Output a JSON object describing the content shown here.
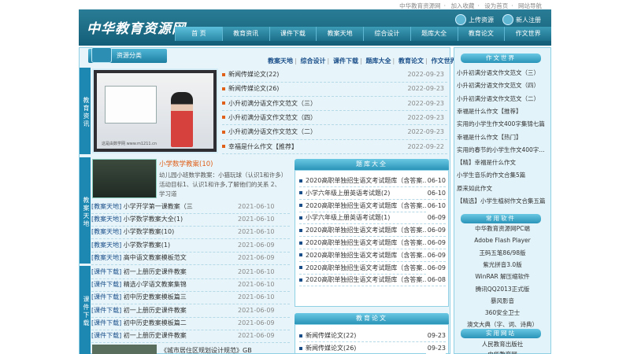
{
  "top": {
    "links": [
      "中华教育资源网",
      "加入收藏",
      "设为首页",
      "网站导航"
    ],
    "sep": "·"
  },
  "header": {
    "logo": "中华教育资源网",
    "upload": "上传资源",
    "register": "新人注册",
    "nav": [
      "首 页",
      "教育资讯",
      "课件下载",
      "教案天地",
      "综合设计",
      "题库大全",
      "教育论文",
      "作文世界"
    ]
  },
  "section1": {
    "title": "资源分类",
    "vtab": "教育资讯",
    "catlinks": [
      "教案天地",
      "综合设计",
      "课件下载",
      "题库大全",
      "教育论文",
      "作文世界"
    ],
    "video_caption": "这是由数学网 www.m1211.cn",
    "news": [
      {
        "title": "新闻传媒论文(22)",
        "date": "2022-09-23"
      },
      {
        "title": "新闻传媒论文(26)",
        "date": "2022-09-23"
      },
      {
        "title": "小升初满分语文作文范文（三）",
        "date": "2022-09-23"
      },
      {
        "title": "小升初满分语文作文范文（四）",
        "date": "2022-09-23"
      },
      {
        "title": "小升初满分语文作文范文（二）",
        "date": "2022-09-23"
      },
      {
        "title": "幸福是什么作文【推荐】",
        "date": "2022-09-22"
      }
    ]
  },
  "section2": {
    "vtab": "教案天地",
    "feature_title": "小学数学教案(10)",
    "feature_desc": "幼儿园小班数学教案：小猫玩球（认识1和许多）活动目标1、认识1和许多,了解他们的关系 2、学习道",
    "items": [
      {
        "tag": "[教案天地]",
        "title": "小学开学第一课教案（三",
        "date": "2021-06-10"
      },
      {
        "tag": "[教案天地]",
        "title": "小学数学教案大全(1)",
        "date": "2021-06-10"
      },
      {
        "tag": "[教案天地]",
        "title": "小学数学教案(10)",
        "date": "2021-06-10"
      },
      {
        "tag": "[教案天地]",
        "title": "小学数学教案(1)",
        "date": "2021-06-09"
      },
      {
        "tag": "[教案天地]",
        "title": "高中语文教案模板范文",
        "date": "2021-06-09"
      }
    ]
  },
  "section3": {
    "vtab": "课件下载",
    "items": [
      {
        "tag": "[课件下载]",
        "title": "初一上册历史课件教案",
        "date": "2021-06-10"
      },
      {
        "tag": "[课件下载]",
        "title": "精选小学语文教案集锦",
        "date": "2021-06-10"
      },
      {
        "tag": "[课件下载]",
        "title": "初中历史教案模板篇三",
        "date": "2021-06-10"
      },
      {
        "tag": "[课件下载]",
        "title": "初一上册历史课件教案",
        "date": "2021-06-09"
      },
      {
        "tag": "[课件下载]",
        "title": "初中历史教案模板篇二",
        "date": "2021-06-09"
      },
      {
        "tag": "[课件下载]",
        "title": "初一上册历史课件教案",
        "date": "2021-06-09"
      }
    ],
    "bottom_title": "《城市居住区规划设计规范》GB"
  },
  "tiku": {
    "title": "题库大全",
    "items": [
      {
        "title": "2020高职单独招生语文考试题库（含答案...",
        "date": "06-10"
      },
      {
        "title": "小学六年级上册英语考试题(2)",
        "date": "06-10"
      },
      {
        "title": "2020高职单独招生语文考试题库（含答案...",
        "date": "06-10"
      },
      {
        "title": "小学六年级上册英语考试题(1)",
        "date": "06-09"
      },
      {
        "title": "2020高职单独招生语文考试题库（含答案...",
        "date": "06-09"
      },
      {
        "title": "2020高职单独招生语文考试题库（含答案...",
        "date": "06-09"
      },
      {
        "title": "2020高职单独招生语文考试题库（含答案...",
        "date": "06-09"
      },
      {
        "title": "2020高职单独招生语文考试题库（含答案...",
        "date": "06-09"
      },
      {
        "title": "2020高职单独招生语文考试题库（含答案...",
        "date": "06-08"
      }
    ]
  },
  "lunwen": {
    "title": "教育论文",
    "items": [
      {
        "title": "新闻传媒论文(22)",
        "date": "09-23"
      },
      {
        "title": "新闻传媒论文(26)",
        "date": "09-23"
      }
    ]
  },
  "right": {
    "zuowen_title": "作文世界",
    "zuowen": [
      "小升初满分语文作文范文（三）",
      "小升初满分语文作文范文（四）",
      "小升初满分语文作文范文（二）",
      "幸福是什么作文【推荐】",
      "实用的小学生作文400字集锦七篇",
      "幸福是什么作文【热门】",
      "实用的春节的小学生作文400字...",
      "【精】幸福是什么作文",
      "小学生音乐的作文合集5篇",
      "原来如此作文",
      "【精选】小学生植树作文合集五篇"
    ],
    "software_title": "常用软件",
    "software": [
      "中华教育资源网PC端",
      "Adobe Flash Player",
      "王码五笔86/98版",
      "紫光拼音3.0版",
      "WinRAR 解压缩软件",
      "腾讯QQ2013正式版",
      "暴风影音",
      "360安全卫士",
      "澳文大典（字、词、诗典）"
    ],
    "sites_title": "实用网站",
    "sites": [
      "人民教育出版社",
      "中华教育网"
    ]
  },
  "colors": {
    "primary": "#1d88b1",
    "accent": "#e0601a",
    "link": "#1b4f8a"
  }
}
